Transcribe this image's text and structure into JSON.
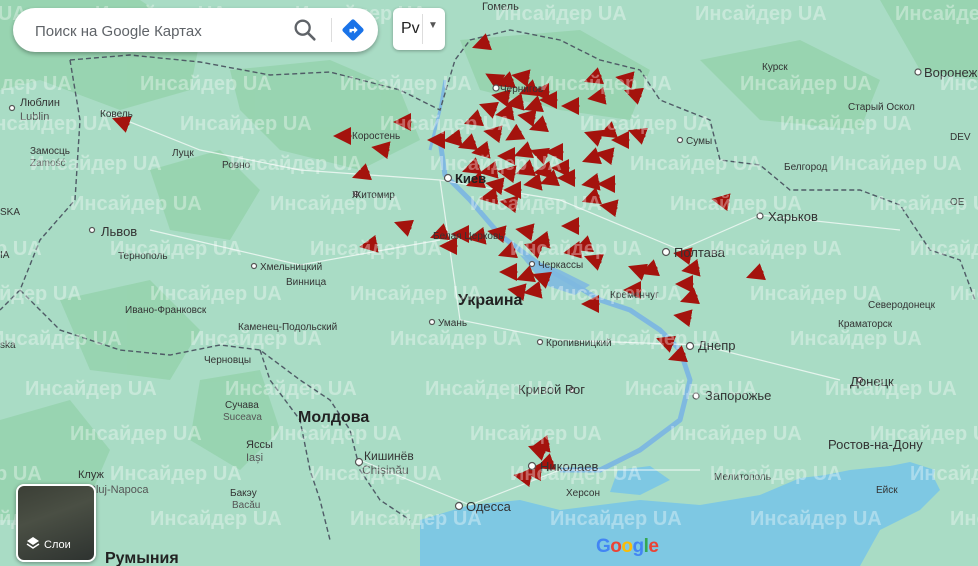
{
  "search": {
    "placeholder": "Поиск на Google Картах"
  },
  "language_button": {
    "label": "Рv"
  },
  "layers_button": {
    "label": "Слои"
  },
  "google_logo": {
    "letters": [
      "G",
      "o",
      "o",
      "g",
      "l",
      "e"
    ],
    "colors": [
      "#4285f4",
      "#ea4335",
      "#fbbc05",
      "#4285f4",
      "#34a853",
      "#ea4335"
    ]
  },
  "colors": {
    "land": "#a9dcc5",
    "sea": "#7ec8e3",
    "forest": "#8fcfa6",
    "arrow": "#a4130d",
    "border": "#4f5b66",
    "river": "#7fb9e0"
  },
  "watermark": {
    "text": "Инсайдер UA"
  },
  "cities": {
    "gomel": "Гомель",
    "lublin": "Люблин",
    "lublin_latin": "Lublin",
    "zamosc": "Замосць",
    "zamosc_latin": "Zamość",
    "kovel": "Ковель",
    "lutsk": "Луцк",
    "rivne": "Ровно",
    "lviv": "Львов",
    "ternopil": "Тернополь",
    "khmelnytskyi": "Хмельницкий",
    "vinnytsia": "Винница",
    "ivano_frankivsk": "Ивано-Франковск",
    "kamianets": "Каменец-Подольский",
    "chernivtsi": "Черновцы",
    "suceava": "Сучава",
    "suceava_latin": "Suceava",
    "iasi": "Яссы",
    "iasi_latin": "Iași",
    "cluj": "Клуж",
    "cluj_latin": "Cluj-Napoca",
    "bacau": "Бакэу",
    "bacau_latin": "Bacău",
    "chernihiv": "Чернигов",
    "korosten": "Коростень",
    "zhytomyr": "Житомир",
    "kyiv": "Киев",
    "bila_tserkva": "Белая Церковь",
    "cherkasy": "Черкассы",
    "uman": "Умань",
    "kropyvnytskyi": "Кропивницкий",
    "kremenchuk": "Кременчуг",
    "poltava": "Полтава",
    "sumy": "Сумы",
    "kursk": "Курск",
    "voronezh": "Воронеж",
    "stary_oskol": "Старый Оскол",
    "belgorod": "Белгород",
    "kharkiv": "Харьков",
    "dnipro": "Днепр",
    "kryvyi_rih": "Кривой Рог",
    "zaporizhzhia": "Запорожье",
    "mykolaiv": "Николаев",
    "kherson": "Херсон",
    "odesa": "Одесса",
    "melitopol": "Мелитополь",
    "donetsk": "Донецк",
    "rostov": "Ростов-на-Дону",
    "yeysk": "Ейск",
    "kramatorsk": "Краматорск",
    "sievierodonetsk": "Северодонецк",
    "chisinau": "Кишинёв",
    "chisinau_latin": "Chișinău",
    "ukraine": "Украина",
    "moldova": "Молдова",
    "romania": "Румыния",
    "partial_ia": "IA",
    "partial_ua": "UA",
    "partial_ska": "SKA",
    "partial_oe": "OE",
    "partial_dev": "DEV",
    "partial_ska2": "ska",
    "partial_va": "ва",
    "partial_j": "j"
  }
}
